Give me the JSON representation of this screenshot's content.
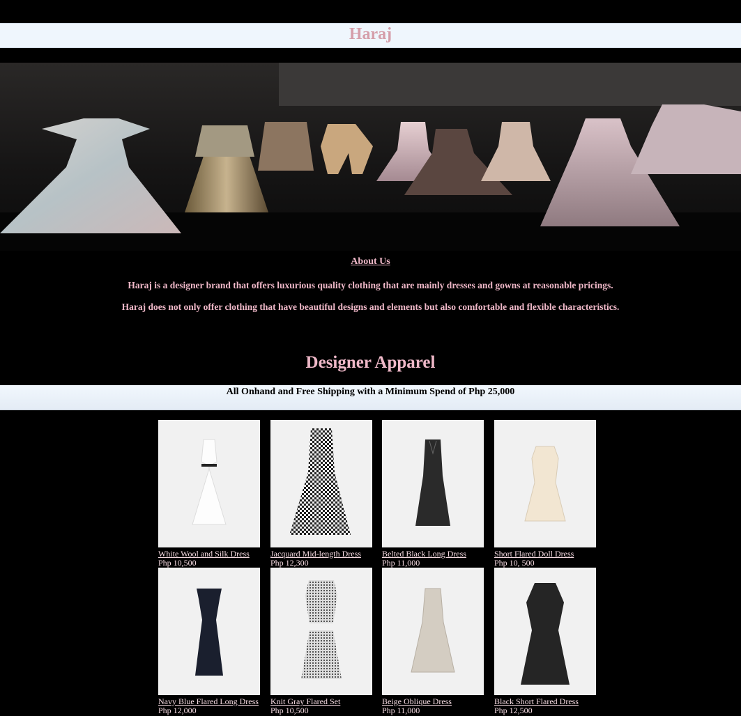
{
  "header": {
    "brand": "Haraj"
  },
  "hero": {
    "image": "designer-gowns-exhibit"
  },
  "about": {
    "heading": "About Us",
    "paragraph1": "Haraj is a designer brand that offers luxurious quality clothing that are mainly dresses and gowns at reasonable pricings.",
    "paragraph2": "Haraj does not only offer clothing that have beautiful designs and elements but also comfortable and flexible characteristics."
  },
  "apparel": {
    "title": "Designer Apparel",
    "shipping_note": "All Onhand and Free Shipping with a Minimum Spend of Php 25,000"
  },
  "products": [
    {
      "name": "White Wool and Silk Dress",
      "price": "Php 10,500",
      "image": "white-dress-image"
    },
    {
      "name": "Jacquard Mid-length Dress",
      "price": "Php 12,300",
      "image": "houndstooth-dress-image"
    },
    {
      "name": "Belted Black Long Dress",
      "price": "Php 11,000",
      "image": "black-long-dress-image"
    },
    {
      "name": "Short Flared Doll Dress",
      "price": "Php 10, 500",
      "image": "cream-doll-dress-image"
    },
    {
      "name": "Navy Blue Flared Long Dress",
      "price": "Php 12,000",
      "image": "navy-long-dress-image"
    },
    {
      "name": "Knit Gray Flared Set",
      "price": "Php 10,500",
      "image": "knit-gray-set-image"
    },
    {
      "name": "Beige Oblique Dress",
      "price": "Php 11,000",
      "image": "beige-oblique-dress-image"
    },
    {
      "name": "Black Short Flared Dress",
      "price": "Php 12,500",
      "image": "black-short-dress-image"
    }
  ],
  "colors": {
    "accent": "#efb8c8",
    "brand": "#d59eaa",
    "bar": "#eff6fd"
  }
}
